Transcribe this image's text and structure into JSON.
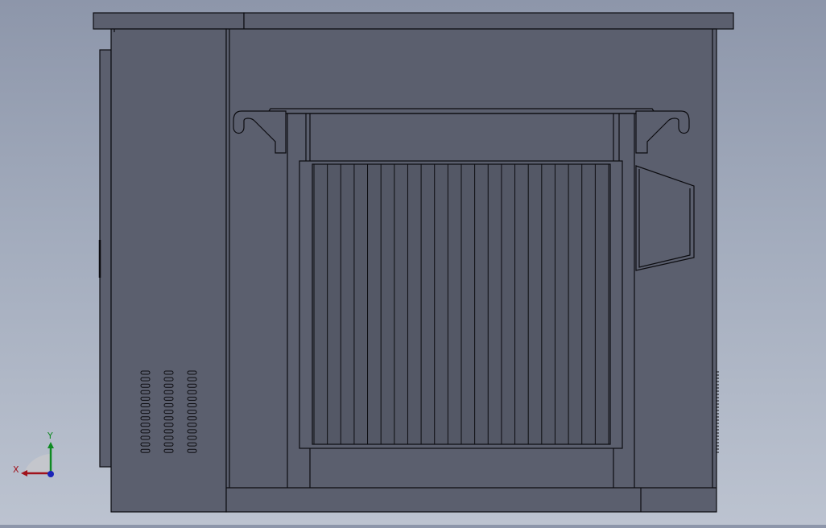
{
  "viewport": {
    "background": [
      "#8d96aa",
      "#bcc3d0"
    ],
    "model_fill": "#5b5f6e",
    "model_fill_dark": "#545866",
    "model_edge": "#0c0c10"
  },
  "model": {
    "name": "enclosure-front-view",
    "vent_slots_per_column": 13,
    "vent_columns": 3,
    "fin_count": 23
  },
  "triad": {
    "x_label": "X",
    "y_label": "Y",
    "x_color": "#a0121c",
    "y_color": "#0f8a22",
    "z_color": "#1a24b8"
  }
}
